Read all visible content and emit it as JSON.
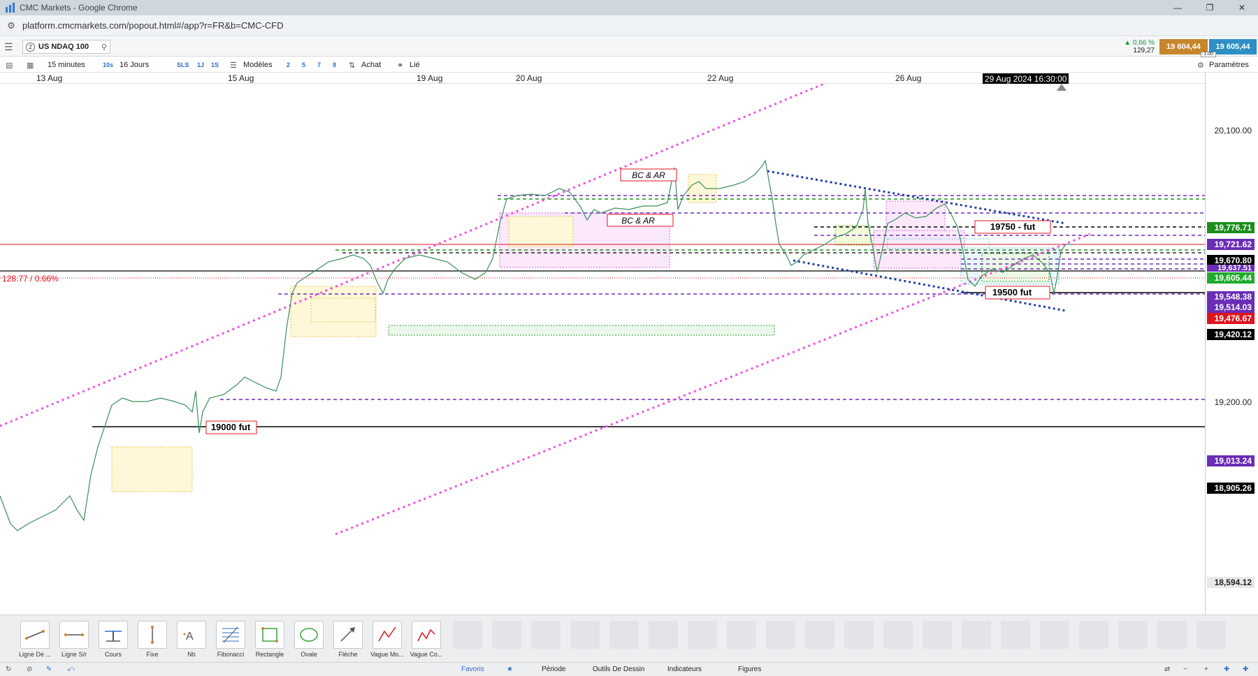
{
  "window": {
    "title": "CMC Markets - Google Chrome"
  },
  "browser": {
    "url": "platform.cmcmarkets.com/popout.html#/app?r=FR&b=CMC-CFD"
  },
  "instrument": {
    "count": "2",
    "name": "US NDAQ 100"
  },
  "quote": {
    "change_pct": "▲ 0,66 %",
    "change_pts": "129,27",
    "sell": "19 604,44",
    "buy": "19 605,44",
    "spread": "1.00"
  },
  "toolbar": {
    "interval": "15 minutes",
    "interval_short": "10s",
    "range": "16 Jours",
    "sls": "SLS",
    "one_j": "1J",
    "one_s": "1S",
    "models": "Modèles",
    "n2": "2",
    "n5": "5",
    "n7": "7",
    "n8": "8",
    "buy": "Achat",
    "linked": "Lié",
    "settings": "Paramètres"
  },
  "dates": [
    "13 Aug",
    "15 Aug",
    "19 Aug",
    "20 Aug",
    "22 Aug",
    "26 Aug"
  ],
  "crosshair_date": "29 Aug 2024 16:30:00",
  "change_label": "128.77 / 0.66%",
  "chart_data": {
    "type": "line",
    "y_ticks": [
      "20,100.00",
      "19,200.00",
      "18,594.12"
    ],
    "levels": [
      {
        "value": "19,776.71",
        "color": "#1b8f1b"
      },
      {
        "value": "19,721.62",
        "color": "#6a2db6"
      },
      {
        "value": "19,670.80",
        "color": "#000000"
      },
      {
        "value": "19,637.51",
        "color": "#6a2db6"
      },
      {
        "value": "19,605.44",
        "color": "#1faa2c"
      },
      {
        "value": "19,548.38",
        "color": "#6a2db6"
      },
      {
        "value": "19,514.03",
        "color": "#6a2db6"
      },
      {
        "value": "19,476.67",
        "color": "#e0141e"
      },
      {
        "value": "19,420.12",
        "color": "#000000"
      },
      {
        "value": "19,013.24",
        "color": "#6a2db6"
      },
      {
        "value": "18,905.26",
        "color": "#000000"
      }
    ],
    "annotations": [
      "BC & AR",
      "BC & AR",
      "19750 - fut",
      "19500 fut",
      "19000 fut"
    ]
  },
  "tools": [
    {
      "label": "Ligne De ..."
    },
    {
      "label": "Ligne S/r"
    },
    {
      "label": "Cours"
    },
    {
      "label": "Fixe"
    },
    {
      "label": "Nb"
    },
    {
      "label": "Fibonacci"
    },
    {
      "label": "Rectangle"
    },
    {
      "label": "Ovale"
    },
    {
      "label": "Flèche"
    },
    {
      "label": "Vague Mo..."
    },
    {
      "label": "Vague Co..."
    }
  ],
  "status": {
    "favorites": "Favoris",
    "period": "Période",
    "drawing": "Outils De Dessin",
    "indicators": "Indicateurs",
    "figures": "Figures"
  }
}
